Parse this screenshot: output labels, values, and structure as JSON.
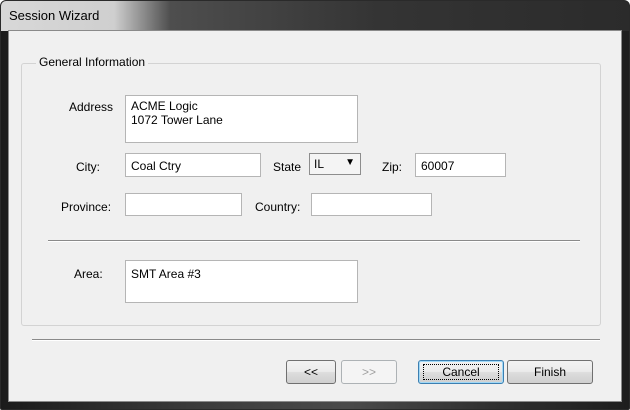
{
  "window": {
    "title": "Session Wizard"
  },
  "group": {
    "title": "General Information"
  },
  "address": {
    "label": "Address",
    "line1": "ACME Logic",
    "line2": "1072 Tower Lane"
  },
  "city": {
    "label": "City:",
    "value": "Coal Ctry"
  },
  "state": {
    "label": "State",
    "value": "IL",
    "arrow": "▼"
  },
  "zip": {
    "label": "Zip:",
    "value": "60007"
  },
  "province": {
    "label": "Province:",
    "value": ""
  },
  "country": {
    "label": "Country:",
    "value": ""
  },
  "area": {
    "label": "Area:",
    "value": "SMT Area #3"
  },
  "buttons": {
    "back": "<<",
    "next": ">>",
    "cancel": "Cancel",
    "finish": "Finish"
  }
}
